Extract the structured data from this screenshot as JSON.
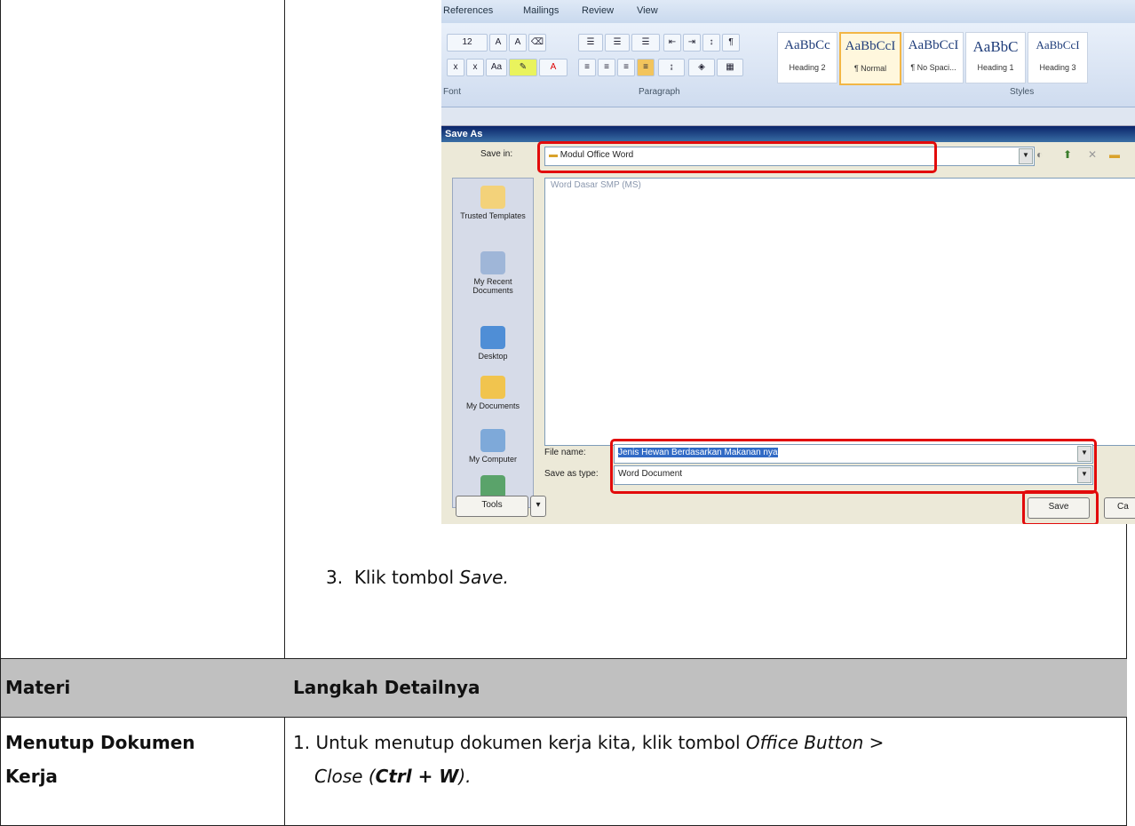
{
  "screenshot": {
    "ribbon_tabs": [
      "References",
      "Mailings",
      "Review",
      "View"
    ],
    "font_size": "12",
    "group_labels": {
      "font": "Font",
      "paragraph": "Paragraph",
      "styles": "Styles"
    },
    "styles": [
      {
        "sample": "AaBbCc",
        "name": "Heading 2"
      },
      {
        "sample": "AaBbCcI",
        "name": "¶ Normal"
      },
      {
        "sample": "AaBbCcI",
        "name": "¶ No Spaci..."
      },
      {
        "sample": "AaBbC",
        "name": "Heading 1"
      },
      {
        "sample": "AaBbCcI",
        "name": "Heading 3"
      }
    ],
    "dialog_title": "Save As",
    "save_in_label": "Save in:",
    "save_in_value": "Modul Office Word",
    "file_item": "Word Dasar SMP (MS)",
    "places": [
      "Trusted Templates",
      "My Recent Documents",
      "Desktop",
      "My Documents",
      "My Computer"
    ],
    "file_name_label": "File name:",
    "file_name_value": "Jenis Hewan Berdasarkan Makanan nya",
    "save_type_label": "Save as type:",
    "save_type_value": "Word Document",
    "tools_label": "Tools",
    "save_label": "Save",
    "cancel_label": "Ca"
  },
  "document": {
    "step3_num": "3.",
    "step3_text": "Klik tombol ",
    "step3_em": "Save.",
    "header_col1": "Materi",
    "header_col2": "Langkah Detailnya",
    "row_title_line1": "Menutup Dokumen",
    "row_title_line2": "Kerja",
    "step1_num": "1.",
    "step1_text": "Untuk menutup dokumen kerja kita, klik tombol ",
    "step1_em": "Office Button >",
    "step1_line2_a": "Close (",
    "step1_line2_b": "Ctrl + W",
    "step1_line2_c": ")."
  }
}
